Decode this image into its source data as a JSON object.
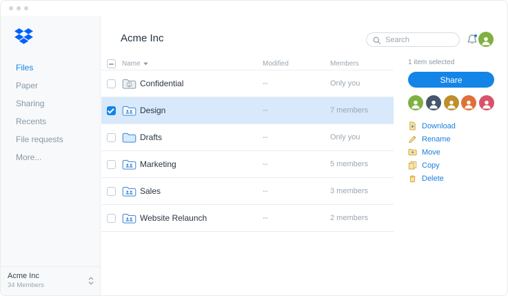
{
  "colors": {
    "accent": "#1385e6",
    "logo": "#0061ff",
    "link": "#1a7de0",
    "row-selected": "#d7e9fb",
    "text": "#2a3442",
    "muted": "#8a97a4",
    "muted2": "#9aa6b1",
    "border": "#e9edf1",
    "sidebar-bg": "#f7f9fa"
  },
  "titlebar": {
    "dots": 3
  },
  "sidebar": {
    "items": [
      {
        "label": "Files",
        "active": true
      },
      {
        "label": "Paper",
        "active": false
      },
      {
        "label": "Sharing",
        "active": false
      },
      {
        "label": "Recents",
        "active": false
      },
      {
        "label": "File requests",
        "active": false
      },
      {
        "label": "More...",
        "active": false
      }
    ],
    "team": {
      "name": "Acme Inc",
      "members": "34 Members"
    }
  },
  "header": {
    "title": "Acme Inc",
    "search_placeholder": "Search",
    "avatar_color": "#7fb13f"
  },
  "table": {
    "columns": {
      "name": "Name",
      "modified": "Modified",
      "members": "Members"
    },
    "sort": {
      "column": "Name",
      "caret": "down"
    },
    "rows": [
      {
        "name": "Confidential",
        "modified": "--",
        "members": "Only you",
        "icon": "folder-private",
        "checked": false,
        "selected": false
      },
      {
        "name": "Design",
        "modified": "--",
        "members": "7 members",
        "icon": "folder-shared",
        "checked": true,
        "selected": true
      },
      {
        "name": "Drafts",
        "modified": "--",
        "members": "Only you",
        "icon": "folder-plain",
        "checked": false,
        "selected": false
      },
      {
        "name": "Marketing",
        "modified": "--",
        "members": "5 members",
        "icon": "folder-shared",
        "checked": false,
        "selected": false
      },
      {
        "name": "Sales",
        "modified": "--",
        "members": "3 members",
        "icon": "folder-shared",
        "checked": false,
        "selected": false
      },
      {
        "name": "Website Relaunch",
        "modified": "--",
        "members": "2 members",
        "icon": "folder-shared",
        "checked": false,
        "selected": false
      }
    ]
  },
  "details": {
    "selection_status": "1 item selected",
    "share_label": "Share",
    "avatars": [
      {
        "color": "#7fb13f"
      },
      {
        "color": "#45566c"
      },
      {
        "color": "#bd8e2a"
      },
      {
        "color": "#df7036"
      },
      {
        "color": "#d8526b"
      }
    ],
    "actions": [
      {
        "label": "Download",
        "icon": "download-icon"
      },
      {
        "label": "Rename",
        "icon": "rename-icon"
      },
      {
        "label": "Move",
        "icon": "move-icon"
      },
      {
        "label": "Copy",
        "icon": "copy-icon"
      },
      {
        "label": "Delete",
        "icon": "delete-icon"
      }
    ]
  }
}
